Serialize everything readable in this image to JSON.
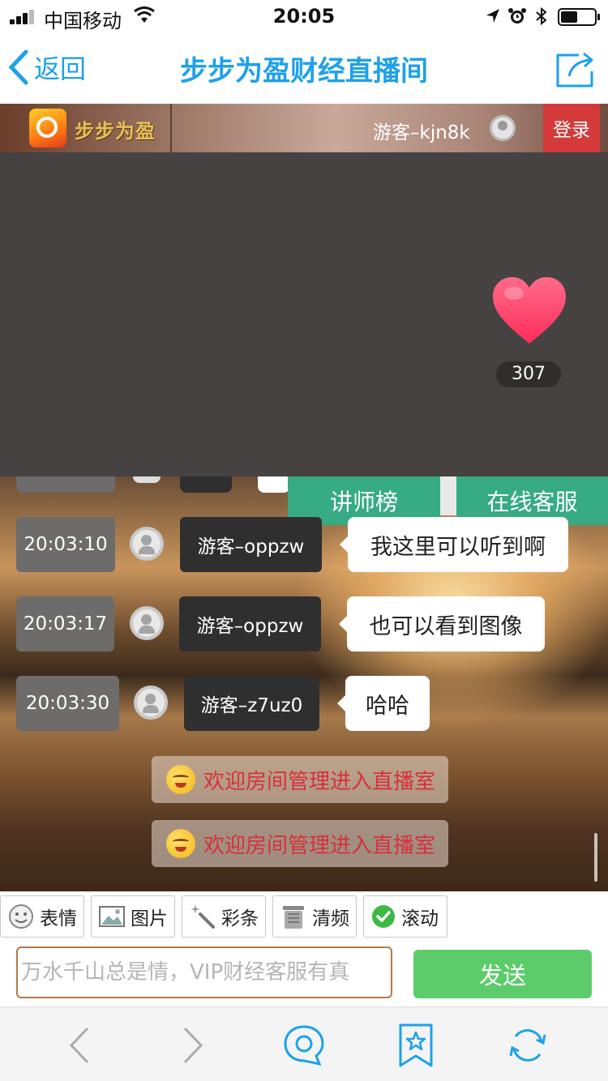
{
  "status_bar": {
    "carrier": "中国移动",
    "time": "20:05",
    "battery_level": 0.45
  },
  "nav": {
    "back_label": "返回",
    "title": "步步为盈财经直播间"
  },
  "live_header": {
    "logo_text": "步步为盈",
    "guest_name": "游客–kjn8k",
    "login_label": "登录"
  },
  "video": {
    "like_count": "307"
  },
  "chat": {
    "tabs": [
      "讲师榜",
      "在线客服"
    ],
    "messages": [
      {
        "time": "20:03:10",
        "user": "游客–oppzw",
        "text": "我这里可以听到啊"
      },
      {
        "time": "20:03:17",
        "user": "游客–oppzw",
        "text": "也可以看到图像"
      },
      {
        "time": "20:03:30",
        "user": "游客–z7uz0",
        "text": "哈哈"
      }
    ],
    "system_notices": [
      "欢迎房间管理进入直播室",
      "欢迎房间管理进入直播室"
    ]
  },
  "toolbar": {
    "items": [
      "表情",
      "图片",
      "彩条",
      "清频",
      "滚动"
    ]
  },
  "composer": {
    "placeholder": "万水千山总是情，VIP财经客服有真",
    "send_label": "发送"
  },
  "colors": {
    "accent_blue": "#1ea1e9",
    "tab_green": "#36ab84",
    "send_green": "#5ccc6a",
    "login_red": "#d43a3a",
    "notice_red": "#d8303a"
  }
}
